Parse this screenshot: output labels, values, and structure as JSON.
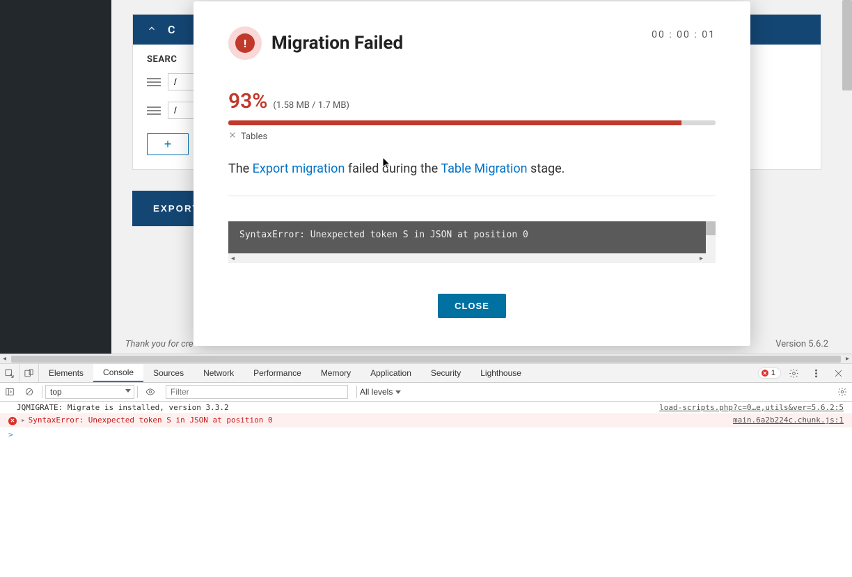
{
  "page": {
    "accordion_label": "C",
    "search_label": "SEARC",
    "input_prefix1": "/",
    "input_prefix2": "/",
    "add_rule": "+",
    "export_btn": "EXPORT",
    "thankyou": "Thank you for cre",
    "version": "Version 5.6.2"
  },
  "modal": {
    "title": "Migration Failed",
    "timer": "00 : 00 : 01",
    "percent": "93%",
    "size": "(1.58 MB / 1.7 MB)",
    "progress_fill": 93,
    "stage": "Tables",
    "fail_pre": "The ",
    "fail_link1": "Export migration",
    "fail_mid": " failed during the ",
    "fail_link2": "Table Migration",
    "fail_post": " stage.",
    "error_text": "SyntaxError: Unexpected token S in JSON at position 0",
    "close": "CLOSE"
  },
  "devtools": {
    "tabs": [
      "Elements",
      "Console",
      "Sources",
      "Network",
      "Performance",
      "Memory",
      "Application",
      "Security",
      "Lighthouse"
    ],
    "active_tab": "Console",
    "error_count": "1",
    "context": "top",
    "filter_placeholder": "Filter",
    "levels": "All levels",
    "rows": [
      {
        "type": "log",
        "msg": "JQMIGRATE: Migrate is installed, version 3.3.2",
        "src": "load-scripts.php?c=0…e,utils&ver=5.6.2:5"
      },
      {
        "type": "err",
        "msg": "SyntaxError: Unexpected token S in JSON at position 0",
        "src": "main.6a2b224c.chunk.js:1"
      }
    ],
    "prompt": ">"
  }
}
